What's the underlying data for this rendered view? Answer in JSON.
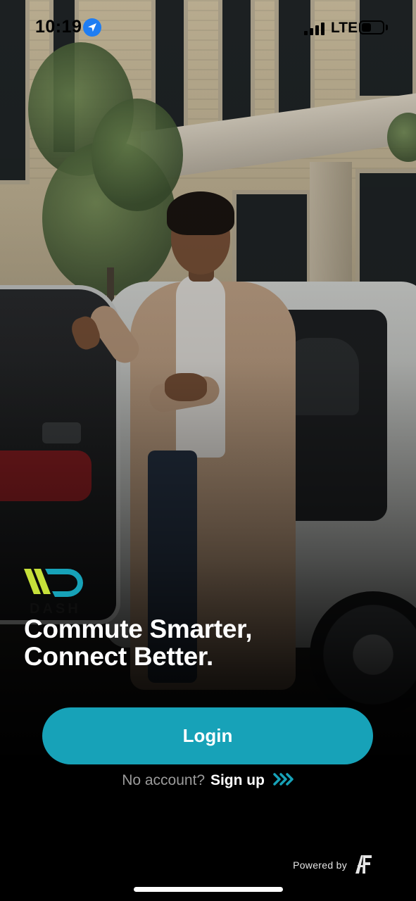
{
  "status_bar": {
    "time": "10:19",
    "network": "LTE",
    "battery_level": 0.45
  },
  "brand": {
    "logo_text": "DASH",
    "accent_color": "#17a2b8",
    "logo_colors": [
      "#c6e03a",
      "#17a2b8"
    ]
  },
  "hero": {
    "line1": "Commute Smarter,",
    "line2": "Connect Better."
  },
  "actions": {
    "login_label": "Login",
    "signup_prompt": "No account?",
    "signup_label": "Sign up"
  },
  "footer": {
    "powered_by": "Powered by",
    "partner_logo": "AFF"
  },
  "icons": [
    "location-arrow-icon",
    "signal-icon",
    "battery-icon",
    "chevron-double-right-icon",
    "partner-logo-icon"
  ]
}
